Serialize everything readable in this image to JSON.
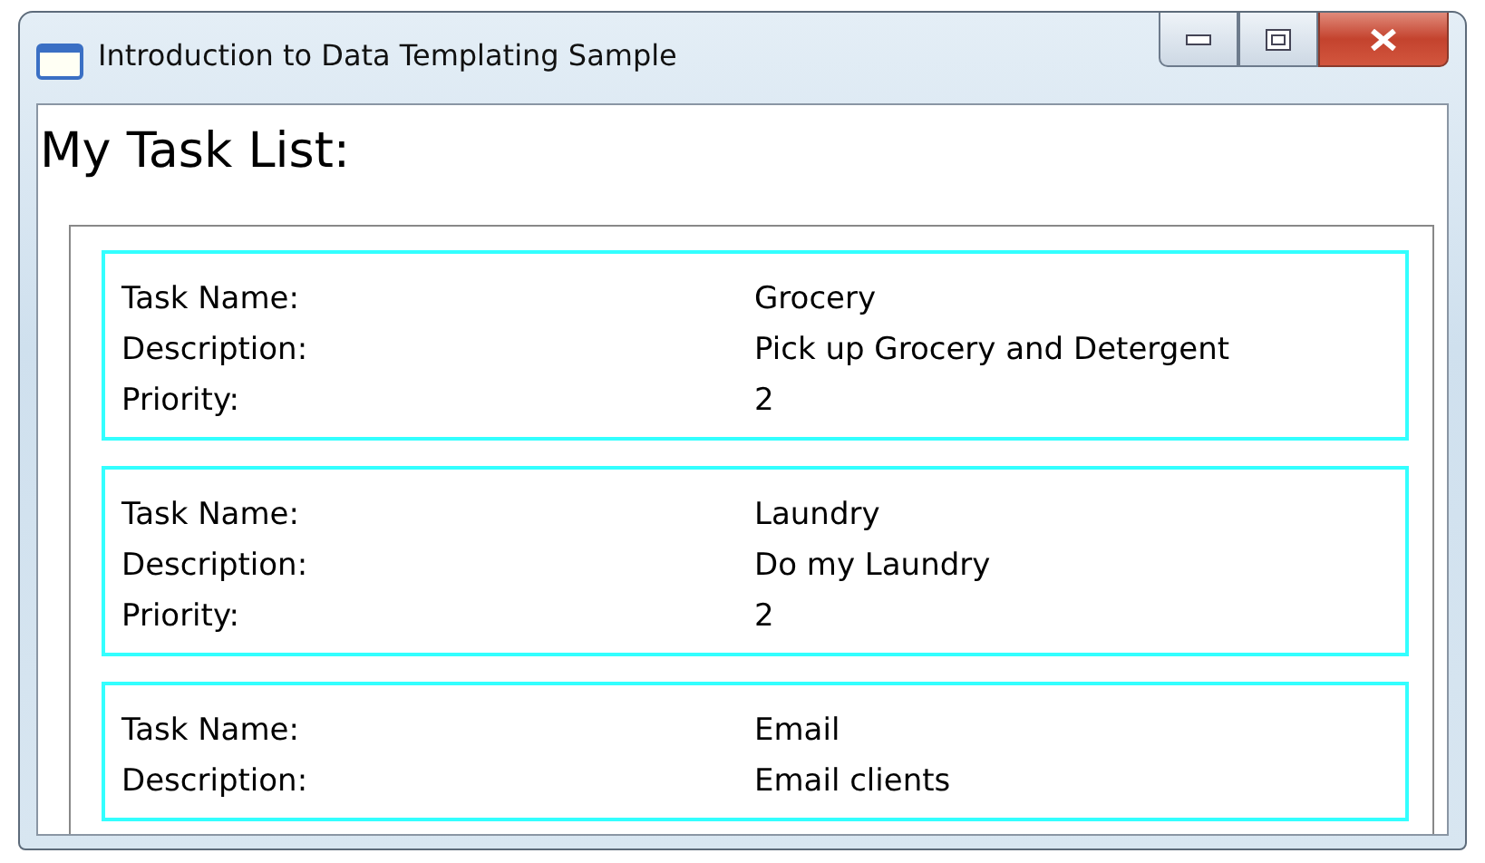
{
  "window": {
    "title": "Introduction to Data Templating Sample"
  },
  "heading": "My Task List:",
  "tasks": [
    {
      "fields": [
        {
          "label": "Task Name:",
          "value": "Grocery"
        },
        {
          "label": "Description:",
          "value": "Pick up Grocery and Detergent"
        },
        {
          "label": "Priority:",
          "value": "2"
        }
      ]
    },
    {
      "fields": [
        {
          "label": "Task Name:",
          "value": "Laundry"
        },
        {
          "label": "Description:",
          "value": "Do my Laundry"
        },
        {
          "label": "Priority:",
          "value": "2"
        }
      ]
    },
    {
      "fields": [
        {
          "label": "Task Name:",
          "value": "Email"
        },
        {
          "label": "Description:",
          "value": "Email clients"
        }
      ]
    }
  ]
}
